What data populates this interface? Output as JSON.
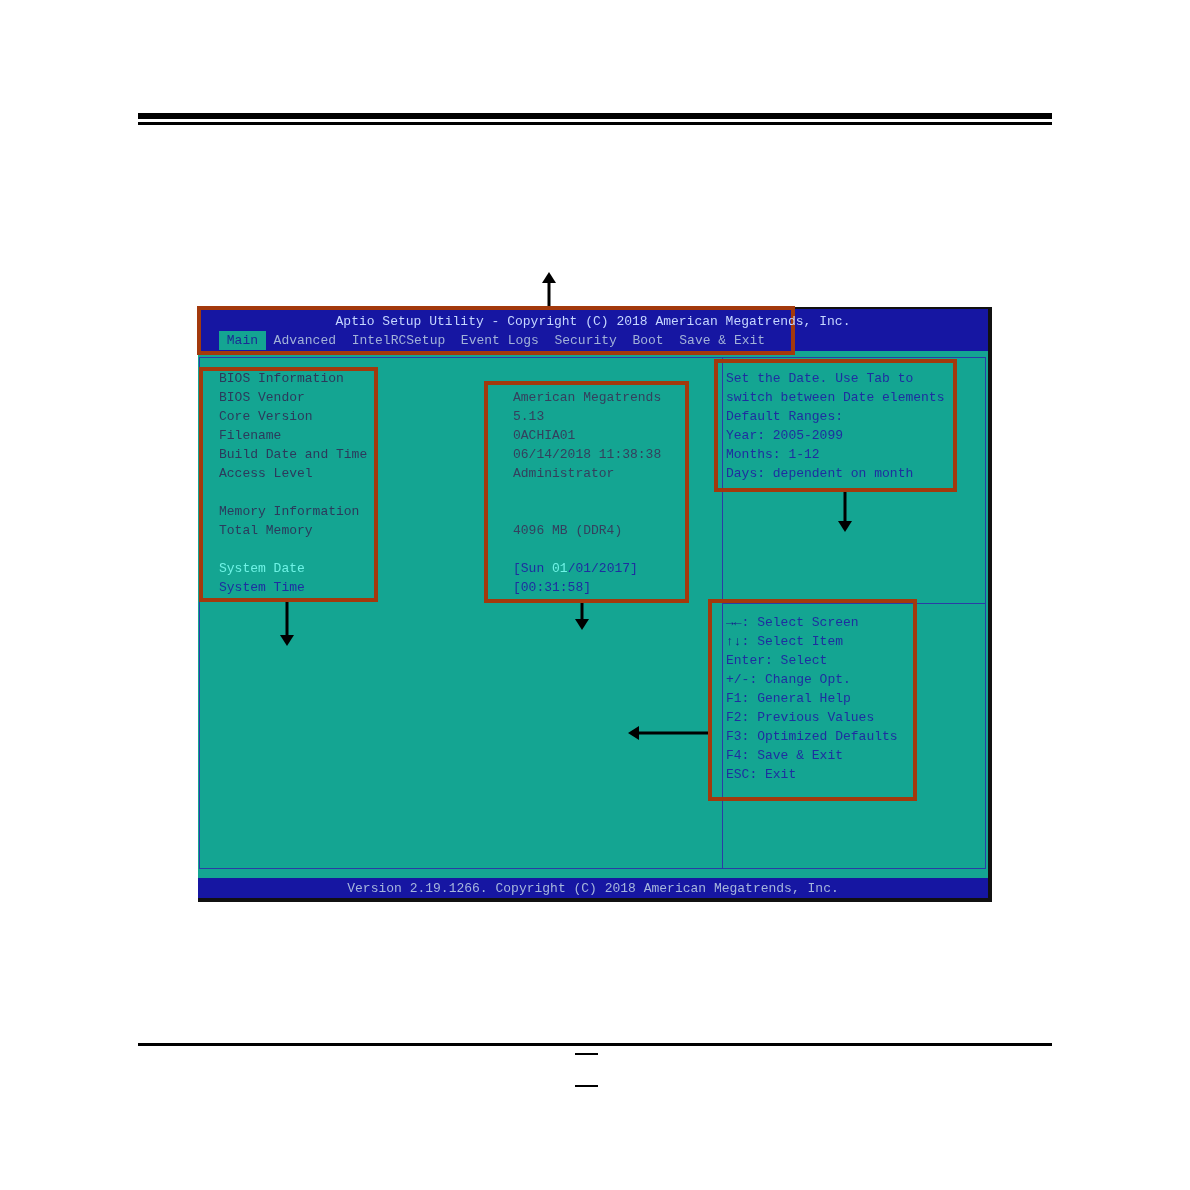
{
  "window": {
    "title": "Aptio Setup Utility - Copyright (C) 2018 American Megatrends, Inc."
  },
  "tabs": [
    {
      "label": "Main",
      "selected": true
    },
    {
      "label": "Advanced",
      "selected": false
    },
    {
      "label": "IntelRCSetup",
      "selected": false
    },
    {
      "label": "Event Logs",
      "selected": false
    },
    {
      "label": "Security",
      "selected": false
    },
    {
      "label": "Boot",
      "selected": false
    },
    {
      "label": "Save & Exit",
      "selected": false
    }
  ],
  "sections": [
    {
      "rows": [
        {
          "kind": "heading",
          "label": "BIOS Information",
          "selected": false
        },
        {
          "kind": "info",
          "label": "BIOS Vendor",
          "value": "American Megatrends",
          "selected": false
        },
        {
          "kind": "info",
          "label": "Core Version",
          "value": "5.13",
          "selected": false
        },
        {
          "kind": "info",
          "label": "Filename",
          "value": "0ACHIA01",
          "selected": false
        },
        {
          "kind": "info",
          "label": "Build Date and Time",
          "value": "06/14/2018 11:38:38",
          "selected": false
        },
        {
          "kind": "info",
          "label": "Access Level",
          "value": "Administrator",
          "selected": false
        }
      ]
    },
    {
      "rows": [
        {
          "kind": "heading",
          "label": "Memory Information",
          "selected": false
        },
        {
          "kind": "info",
          "label": "Total Memory",
          "value": "4096 MB (DDR4)",
          "selected": false
        }
      ]
    },
    {
      "rows": [
        {
          "kind": "field",
          "label": "System Date",
          "selected": true,
          "value_parts": [
            {
              "text": "[Sun ",
              "selected": false
            },
            {
              "text": "01",
              "selected": true
            },
            {
              "text": "/01/2017]",
              "selected": false
            }
          ]
        },
        {
          "kind": "field",
          "label": "System Time",
          "selected": false,
          "value_parts": [
            {
              "text": "[00:31:58]",
              "selected": false
            }
          ]
        }
      ]
    }
  ],
  "help": {
    "lines": [
      "Set the Date. Use Tab to",
      "switch between Date elements",
      "Default Ranges:",
      "Year: 2005-2099",
      "Months: 1-12",
      "Days: dependent on month"
    ]
  },
  "key_hints": [
    "**→←**: Select Screen",
    "**↑↓**: Select Item",
    "Enter: Select",
    "+/-: Change Opt.",
    "F1: General Help",
    "F2: Previous Values",
    "F3: Optimized Defaults",
    "F4: Save & Exit",
    "ESC: Exit"
  ],
  "status_bar": {
    "text": "Version 2.19.1266. Copyright (C) 2018 American Megatrends, Inc."
  },
  "annotations": [
    {
      "kind": "frame"
    },
    {
      "kind": "frame"
    },
    {
      "kind": "frame"
    },
    {
      "kind": "frame"
    },
    {
      "kind": "frame"
    },
    {
      "kind": "arrow"
    },
    {
      "kind": "arrow"
    },
    {
      "kind": "arrow"
    },
    {
      "kind": "arrow"
    },
    {
      "kind": "arrow"
    }
  ]
}
